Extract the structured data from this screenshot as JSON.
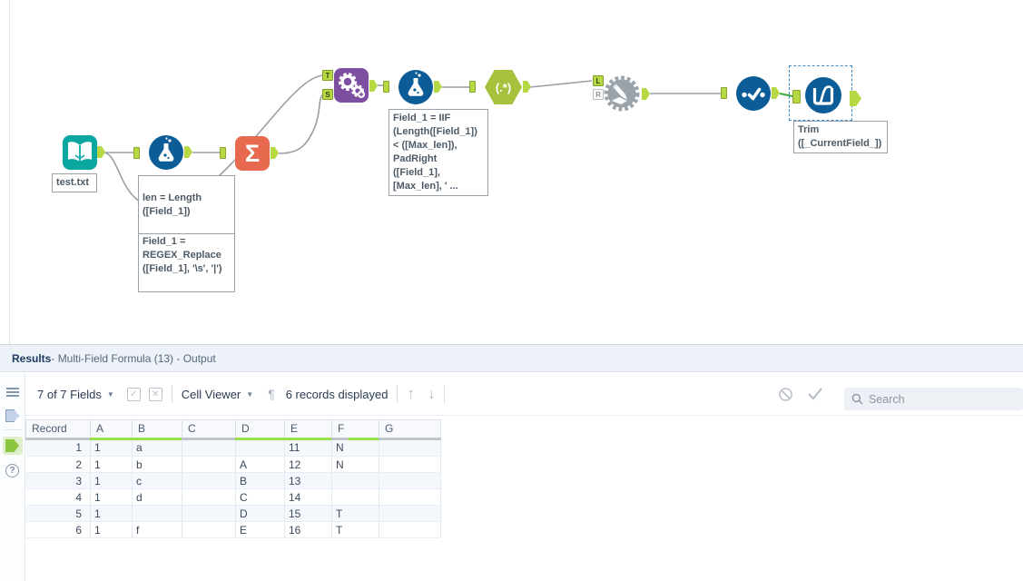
{
  "app": {
    "name": "Alteryx Designer"
  },
  "colors": {
    "input_teal": "#0aa6a0",
    "tool_blue": "#0c5c97",
    "summarize_orange": "#e76a4f",
    "append_purple": "#7c4fa0",
    "regex_green": "#a6c23d",
    "gear_gray": "#99a3a9",
    "anchor_green": "#b5d843",
    "wire_gray": "#999fa6",
    "selected_wire_green": "#3da53d",
    "selection_dash_blue": "#3c8dcc",
    "quality_ok_green": "#98e04e",
    "quality_empty_gray": "#bfc5cc"
  },
  "workflow": {
    "tools": [
      {
        "type": "Input Data",
        "icon": "book-icon",
        "annotation": "test.txt"
      },
      {
        "type": "Formula",
        "icon": "flask-icon",
        "annotation_top": "len = Length\n([Field_1])",
        "annotation_bottom": "Field_1 =\nREGEX_Replace\n([Field_1], '\\s', '|')"
      },
      {
        "type": "Summarize",
        "icon": "sigma-icon",
        "glyph": "Σ"
      },
      {
        "type": "Append Fields",
        "icon": "gears-plus-icon",
        "anchor_top": "T",
        "anchor_bottom": "S"
      },
      {
        "type": "Formula",
        "icon": "flask-icon",
        "annotation": "Field_1 = IIF\n(Length([Field_1])\n< ([Max_len]),\nPadRight\n([Field_1],\n[Max_len], ' ..."
      },
      {
        "type": "RegEx",
        "icon": "regex-hexagon-icon",
        "glyph": "(.*)"
      },
      {
        "type": "Dynamic Rename",
        "icon": "gear-pencil-icon",
        "anchor_top": "L",
        "anchor_bottom": "R"
      },
      {
        "type": "Select",
        "icon": "dots-check-icon"
      },
      {
        "type": "Multi-Field Formula",
        "icon": "container-formula-icon",
        "selected": true,
        "annotation": "Trim\n([_CurrentField_])"
      }
    ]
  },
  "results_panel": {
    "title_bold": "Results",
    "title_rest": " - Multi-Field Formula (13) - Output",
    "toolbar": {
      "fields_summary": "7 of 7 Fields",
      "cell_viewer": "Cell Viewer",
      "pilcrow": "¶",
      "records_displayed": "6 records displayed",
      "up_arrow": "↑",
      "down_arrow": "↓",
      "check_glyph": "✓",
      "x_glyph": "✕",
      "icons": [
        "select-fields-check-icon",
        "deselect-fields-icon",
        "pilcrow-icon",
        "prev-record-icon",
        "next-record-icon",
        "no-symbol-icon",
        "apply-check-icon",
        "search-icon"
      ]
    },
    "search": {
      "placeholder": "Search"
    },
    "strip_icons": [
      "metadata-list-icon",
      "input-anchor-icon",
      "output-anchor-icon",
      "help-icon"
    ],
    "help_glyph": "?",
    "table": {
      "columns": [
        {
          "label": "Record",
          "quality": "empty"
        },
        {
          "label": "A",
          "quality": "ok"
        },
        {
          "label": "B",
          "quality": "ok"
        },
        {
          "label": "C",
          "quality": "empty"
        },
        {
          "label": "D",
          "quality": "ok"
        },
        {
          "label": "E",
          "quality": "ok"
        },
        {
          "label": "F",
          "quality": "mixed"
        },
        {
          "label": "G",
          "quality": "empty"
        }
      ],
      "rows": [
        [
          "1",
          "1",
          "a",
          "",
          "",
          "11",
          "N",
          ""
        ],
        [
          "2",
          "1",
          "b",
          "",
          "A",
          "12",
          "N",
          ""
        ],
        [
          "3",
          "1",
          "c",
          "",
          "B",
          "13",
          "",
          ""
        ],
        [
          "4",
          "1",
          "d",
          "",
          "C",
          "14",
          "",
          ""
        ],
        [
          "5",
          "1",
          "",
          "",
          "D",
          "15",
          "T",
          ""
        ],
        [
          "6",
          "1",
          "f",
          "",
          "E",
          "16",
          "T",
          ""
        ]
      ]
    }
  }
}
